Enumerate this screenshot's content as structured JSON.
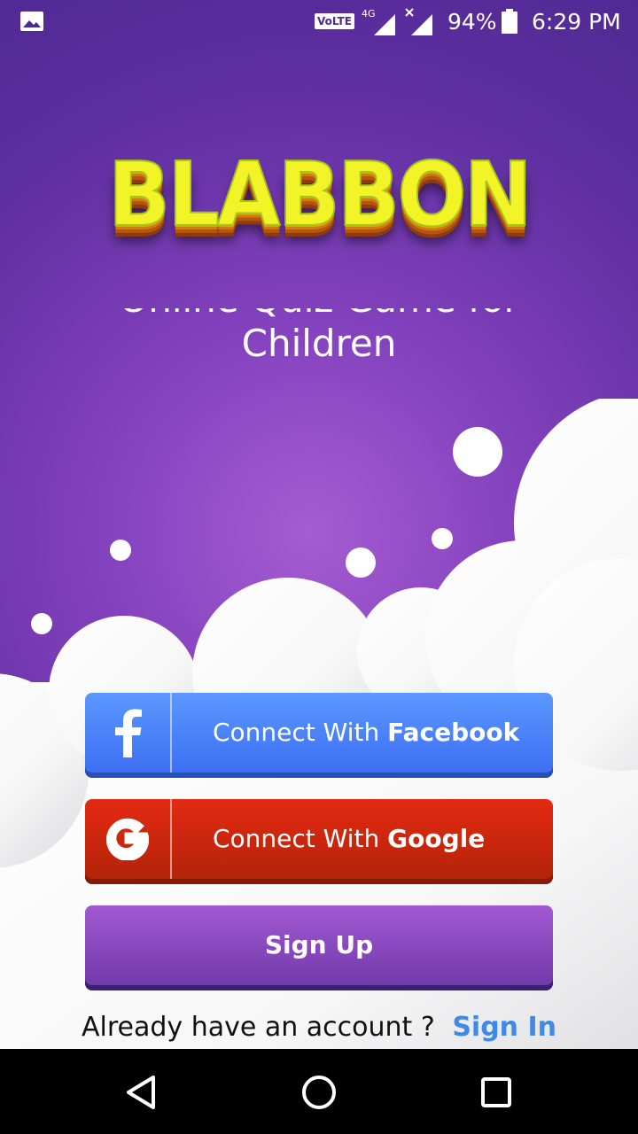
{
  "status_bar": {
    "network_badge": "VoLTE",
    "network_type": "4G",
    "battery": "94%",
    "time": "6:29 PM",
    "icons": [
      "gallery-icon",
      "signal-icon",
      "signal-no-service-icon",
      "battery-icon"
    ]
  },
  "logo": {
    "text": "BLABBON"
  },
  "tagline": {
    "line1": "Online Quiz Game for",
    "line2": "Children"
  },
  "buttons": {
    "facebook": {
      "prefix": "Connect With ",
      "brand": "Facebook",
      "icon": "facebook-icon"
    },
    "google": {
      "prefix": "Connect With ",
      "brand": "Google",
      "icon": "google-icon"
    },
    "signup": {
      "label": "Sign Up"
    }
  },
  "signin": {
    "prompt": "Already have an account ?",
    "link": "Sign In"
  },
  "nav_bar": {
    "icons": [
      "back-icon",
      "home-icon",
      "recents-icon"
    ]
  },
  "colors": {
    "background_top": "#4b278f",
    "background_center": "#a65cd2",
    "facebook": "#3a6cf2",
    "google": "#c4260b",
    "signup": "#8a47bf",
    "signin_link": "#3e8ae5",
    "logo": "#f3f427"
  }
}
